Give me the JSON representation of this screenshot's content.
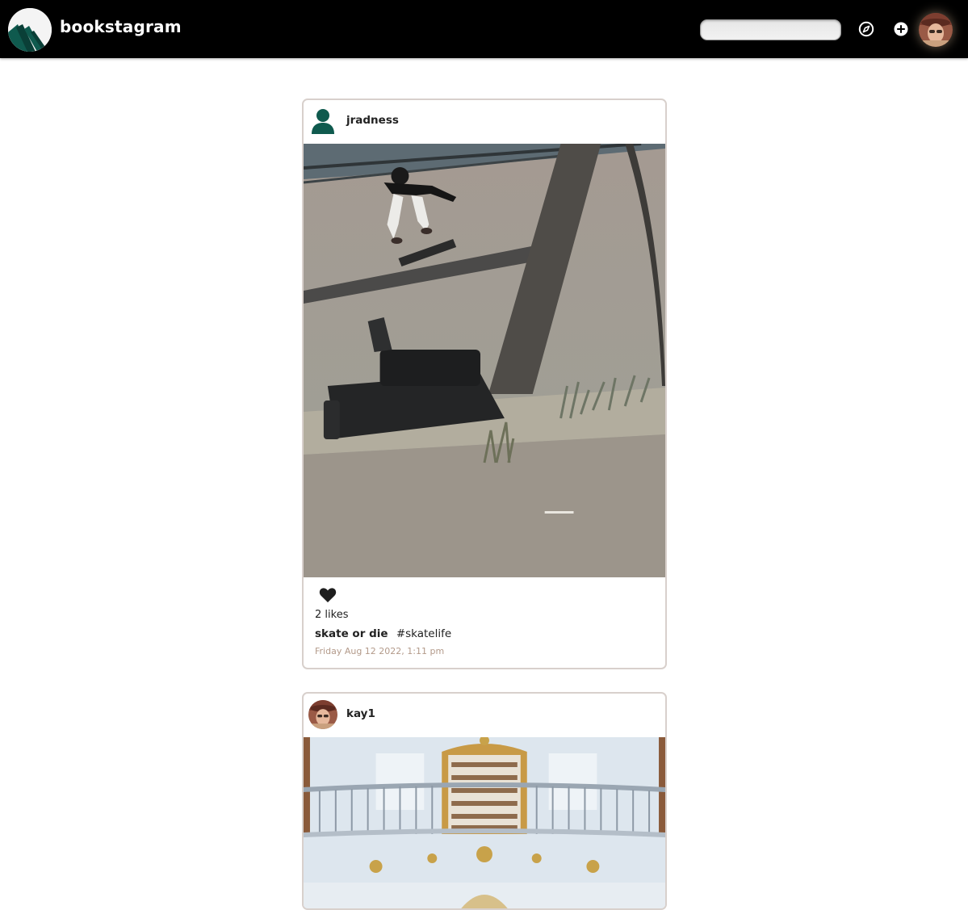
{
  "header": {
    "brand": "bookstagram",
    "search_placeholder": "",
    "icons": {
      "logo": "bookstagram-logo-mountains",
      "explore": "compass-icon",
      "add": "plus-circle-icon",
      "profile": "user-avatar-photo"
    }
  },
  "colors": {
    "topbar": "#000000",
    "brand_green": "#0f5a4e",
    "timestamp": "#b39a8a",
    "card_border": "#d8d0cc"
  },
  "feed": {
    "posts": [
      {
        "username": "jradness",
        "avatar": "default-person-icon",
        "image": "skateboarder-jumping-over-couch",
        "likes": "2 likes",
        "caption": "skate or die",
        "hashtag": "#skatelife",
        "timestamp": "Friday Aug 12 2022, 1:11 pm"
      },
      {
        "username": "kay1",
        "avatar": "user-avatar-photo",
        "image": "baroque-library-hall"
      }
    ]
  }
}
